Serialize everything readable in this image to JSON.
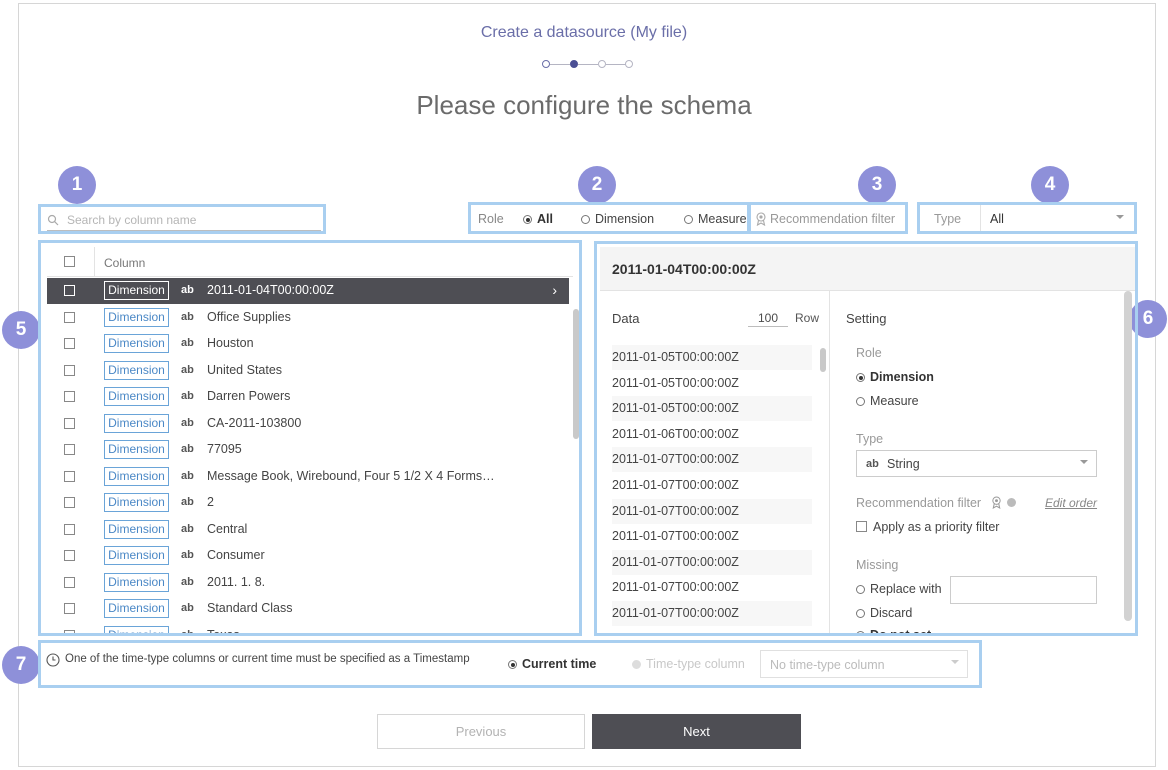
{
  "header": {
    "title": "Create a datasource (My file)",
    "subtitle": "Please configure the schema"
  },
  "steps": {
    "total": 4,
    "current": 2
  },
  "badges": [
    "1",
    "2",
    "3",
    "4",
    "5",
    "6",
    "7"
  ],
  "search": {
    "placeholder": "Search by column name"
  },
  "role_filter": {
    "label": "Role",
    "options": [
      {
        "label": "All",
        "selected": true
      },
      {
        "label": "Dimension",
        "selected": false
      },
      {
        "label": "Measure",
        "selected": false
      }
    ]
  },
  "recommendation_filter": {
    "label": "Recommendation filter"
  },
  "type_filter": {
    "label": "Type",
    "value": "All"
  },
  "column_list": {
    "header": "Column",
    "rows": [
      {
        "role": "Dimension",
        "type": "ab",
        "name": "2011-01-04T00:00:00Z",
        "selected": true
      },
      {
        "role": "Dimension",
        "type": "ab",
        "name": "Office Supplies"
      },
      {
        "role": "Dimension",
        "type": "ab",
        "name": "Houston"
      },
      {
        "role": "Dimension",
        "type": "ab",
        "name": "United States"
      },
      {
        "role": "Dimension",
        "type": "ab",
        "name": "Darren Powers"
      },
      {
        "role": "Dimension",
        "type": "ab",
        "name": "CA-2011-103800"
      },
      {
        "role": "Dimension",
        "type": "ab",
        "name": "77095"
      },
      {
        "role": "Dimension",
        "type": "ab",
        "name": "Message Book, Wirebound, Four 5 1/2 X 4 Forms…"
      },
      {
        "role": "Dimension",
        "type": "ab",
        "name": "2"
      },
      {
        "role": "Dimension",
        "type": "ab",
        "name": "Central"
      },
      {
        "role": "Dimension",
        "type": "ab",
        "name": "Consumer"
      },
      {
        "role": "Dimension",
        "type": "ab",
        "name": "2011. 1. 8."
      },
      {
        "role": "Dimension",
        "type": "ab",
        "name": "Standard Class"
      },
      {
        "role": "Dimension",
        "type": "ab",
        "name": "Texas"
      }
    ]
  },
  "detail": {
    "title": "2011-01-04T00:00:00Z",
    "data_label": "Data",
    "row_count": "100",
    "row_label": "Row",
    "values": [
      "2011-01-05T00:00:00Z",
      "2011-01-05T00:00:00Z",
      "2011-01-05T00:00:00Z",
      "2011-01-06T00:00:00Z",
      "2011-01-07T00:00:00Z",
      "2011-01-07T00:00:00Z",
      "2011-01-07T00:00:00Z",
      "2011-01-07T00:00:00Z",
      "2011-01-07T00:00:00Z",
      "2011-01-07T00:00:00Z",
      "2011-01-07T00:00:00Z",
      "2011-01-07T00:00:00Z"
    ],
    "setting": {
      "title": "Setting",
      "role_label": "Role",
      "role_dimension": "Dimension",
      "role_measure": "Measure",
      "type_label": "Type",
      "type_value": "String",
      "type_prefix": "ab",
      "rec_label": "Recommendation filter",
      "edit_order": "Edit order",
      "priority_label": "Apply as a priority filter",
      "missing_label": "Missing",
      "replace_label": "Replace with",
      "discard_label": "Discard",
      "not_set_label": "Do not set"
    }
  },
  "timestamp": {
    "message": "One of the time-type columns or current time must be specified as a Timestamp",
    "current_time": "Current time",
    "time_column": "Time-type column",
    "select_placeholder": "No time-type column"
  },
  "buttons": {
    "previous": "Previous",
    "next": "Next"
  },
  "colors": {
    "accent": "#6a6ea8",
    "badge": "#8e90d9",
    "highlight": "#a9cff0",
    "dark": "#4e4e54",
    "tag": "#4b88c6"
  }
}
